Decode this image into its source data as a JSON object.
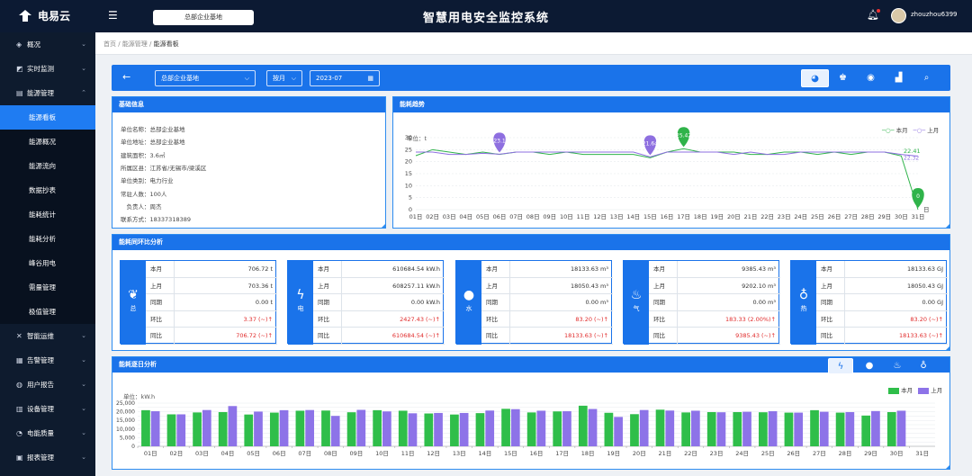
{
  "app": {
    "name": "电易云",
    "title": "智慧用电安全监控系统",
    "org": "总部企业基地",
    "user": "zhouzhou6399"
  },
  "sidebar": {
    "items": [
      {
        "label": "概况",
        "icon": "overview-icon",
        "glyph": "◈"
      },
      {
        "label": "实时监测",
        "icon": "monitor-icon",
        "glyph": "◩"
      },
      {
        "label": "能源管理",
        "icon": "energy-icon",
        "glyph": "▤",
        "expanded": true,
        "children": [
          "能源看板",
          "能源概况",
          "能源流向",
          "数据抄表",
          "能耗统计",
          "能耗分析",
          "峰谷用电",
          "需量管理",
          "极值管理"
        ],
        "active_child": "能源看板"
      },
      {
        "label": "智能运维",
        "icon": "wrench-icon",
        "glyph": "✕"
      },
      {
        "label": "告警管理",
        "icon": "alarm-icon",
        "glyph": "▦"
      },
      {
        "label": "用户报告",
        "icon": "report-icon",
        "glyph": "◍"
      },
      {
        "label": "设备管理",
        "icon": "device-icon",
        "glyph": "▥"
      },
      {
        "label": "电能质量",
        "icon": "quality-icon",
        "glyph": "◔"
      },
      {
        "label": "报表管理",
        "icon": "table-icon",
        "glyph": "▣"
      }
    ]
  },
  "breadcrumb": [
    "首页",
    "能源管理",
    "能源看板"
  ],
  "toolbar": {
    "org": "总部企业基地",
    "period": "按月",
    "date": "2023-07"
  },
  "basic_info": {
    "title": "基础信息",
    "lines": [
      "单位名称：总部企业基地",
      "单位地址：总部企业基地",
      "建筑面积：3.6㎡",
      "所属区县：江苏省/无锡市/梁溪区",
      "单位类别：电力行业",
      "常驻人数：100人",
      "　负责人：周杰",
      "联系方式：18337318389"
    ]
  },
  "trend": {
    "title": "能耗趋势",
    "unit": "单位：t",
    "legend": [
      "本月",
      "上月"
    ],
    "x_unit": "日"
  },
  "compare": {
    "title": "能耗同环比分析",
    "cards": [
      {
        "tag": "总",
        "icon": "leaf-icon",
        "glyph": "❦",
        "rows": [
          [
            "本月",
            "706.72 t",
            false
          ],
          [
            "上月",
            "703.36 t",
            false
          ],
          [
            "同期",
            "0.00 t",
            false
          ],
          [
            "环比",
            "3.37 (~)↑",
            true
          ],
          [
            "同比",
            "706.72 (~)↑",
            true
          ]
        ]
      },
      {
        "tag": "电",
        "icon": "lightning-icon",
        "glyph": "ϟ",
        "rows": [
          [
            "本月",
            "610684.54 kW.h",
            false
          ],
          [
            "上月",
            "608257.11 kW.h",
            false
          ],
          [
            "同期",
            "0.00 kW.h",
            false
          ],
          [
            "环比",
            "2427.43 (~)↑",
            true
          ],
          [
            "同比",
            "610684.54 (~)↑",
            true
          ]
        ]
      },
      {
        "tag": "水",
        "icon": "water-drop-icon",
        "glyph": "●",
        "rows": [
          [
            "本月",
            "18133.63 m³",
            false
          ],
          [
            "上月",
            "18050.43 m³",
            false
          ],
          [
            "同期",
            "0.00 m³",
            false
          ],
          [
            "环比",
            "83.20 (~)↑",
            true
          ],
          [
            "同比",
            "18133.63 (~)↑",
            true
          ]
        ]
      },
      {
        "tag": "气",
        "icon": "flame-icon",
        "glyph": "♨",
        "rows": [
          [
            "本月",
            "9385.43 m³",
            false
          ],
          [
            "上月",
            "9202.10 m³",
            false
          ],
          [
            "同期",
            "0.00 m³",
            false
          ],
          [
            "环比",
            "183.33 (2.00%)↑",
            true
          ],
          [
            "同比",
            "9385.43 (~)↑",
            true
          ]
        ]
      },
      {
        "tag": "热",
        "icon": "thermometer-icon",
        "glyph": "♁",
        "rows": [
          [
            "本月",
            "18133.63 GJ",
            false
          ],
          [
            "上月",
            "18050.43 GJ",
            false
          ],
          [
            "同期",
            "0.00 GJ",
            false
          ],
          [
            "环比",
            "83.20 (~)↑",
            true
          ],
          [
            "同比",
            "18133.63 (~)↑",
            true
          ]
        ]
      }
    ]
  },
  "daily": {
    "title": "能耗逐日分析",
    "unit": "单位：kW.h",
    "legend": [
      "本月",
      "上月"
    ]
  },
  "colors": {
    "topbar": "#0c1a33",
    "accent": "#1a73ea",
    "this_month_line": "#2fb34a",
    "last_month_line": "#8e6fe0",
    "bar_this": "#2fbe4a",
    "bar_last": "#8d73e8"
  },
  "chart_data": [
    {
      "type": "line",
      "title": "能耗趋势",
      "ylabel": "单位：t",
      "ylim": [
        0,
        30
      ],
      "yticks": [
        0,
        5,
        10,
        15,
        20,
        25,
        30
      ],
      "x": [
        "01日",
        "02日",
        "03日",
        "04日",
        "05日",
        "06日",
        "07日",
        "08日",
        "09日",
        "10日",
        "11日",
        "12日",
        "13日",
        "14日",
        "15日",
        "16日",
        "17日",
        "18日",
        "19日",
        "20日",
        "21日",
        "22日",
        "23日",
        "24日",
        "25日",
        "26日",
        "27日",
        "28日",
        "29日",
        "30日",
        "31日"
      ],
      "series": [
        {
          "name": "本月",
          "values": [
            22.5,
            25,
            24,
            23,
            24,
            23,
            24,
            24,
            23,
            24,
            23,
            23,
            23,
            23,
            21.6,
            24,
            25.4,
            24,
            24,
            24,
            23,
            23,
            24,
            24,
            23,
            24,
            23,
            24,
            24,
            22.4,
            0
          ],
          "markers": [
            {
              "x": "17日",
              "label": "25.42"
            },
            {
              "x": "31日",
              "label": "0"
            }
          ]
        },
        {
          "name": "上月",
          "values": [
            24,
            24,
            23,
            23,
            23.5,
            23.1,
            24,
            24,
            24,
            24,
            24,
            24,
            24,
            24,
            22,
            24,
            24,
            24,
            24,
            23,
            24,
            23,
            23,
            24,
            24,
            24,
            24,
            24,
            24,
            23,
            22.3
          ],
          "markers": [
            {
              "x": "06日",
              "label": "23.1"
            },
            {
              "x": "15日",
              "label": "21.64"
            }
          ]
        }
      ],
      "annotations": [
        "22.41",
        "22.32"
      ],
      "legend": "top-right",
      "grid": true
    },
    {
      "type": "bar",
      "title": "能耗逐日分析",
      "ylabel": "单位：kW.h",
      "ylim": [
        0,
        25000
      ],
      "yticks": [
        0,
        2500,
        5000,
        7500,
        10000,
        12500,
        15000,
        17500,
        20000,
        22500,
        25000
      ],
      "categories": [
        "01日",
        "02日",
        "03日",
        "04日",
        "05日",
        "06日",
        "07日",
        "08日",
        "09日",
        "10日",
        "11日",
        "12日",
        "13日",
        "14日",
        "15日",
        "16日",
        "17日",
        "18日",
        "19日",
        "20日",
        "21日",
        "22日",
        "23日",
        "24日",
        "25日",
        "26日",
        "27日",
        "28日",
        "29日",
        "30日",
        "31日"
      ],
      "series": [
        {
          "name": "本月",
          "values": [
            20900,
            18500,
            19600,
            19800,
            18400,
            19500,
            20600,
            20700,
            19700,
            20900,
            20600,
            19000,
            18400,
            19200,
            21700,
            19600,
            20200,
            23500,
            19400,
            18600,
            21200,
            19600,
            19800,
            19800,
            19700,
            19500,
            20900,
            19500,
            17800,
            19800,
            0
          ]
        },
        {
          "name": "上月",
          "values": [
            20300,
            18500,
            21000,
            23300,
            20100,
            20900,
            21000,
            17600,
            21100,
            20200,
            19100,
            19300,
            19300,
            20700,
            21500,
            20600,
            20300,
            21600,
            17000,
            21000,
            20700,
            20600,
            19700,
            20000,
            20300,
            19500,
            20000,
            19800,
            20400,
            20600,
            0
          ]
        }
      ],
      "legend": "top-right",
      "grid": true
    }
  ]
}
